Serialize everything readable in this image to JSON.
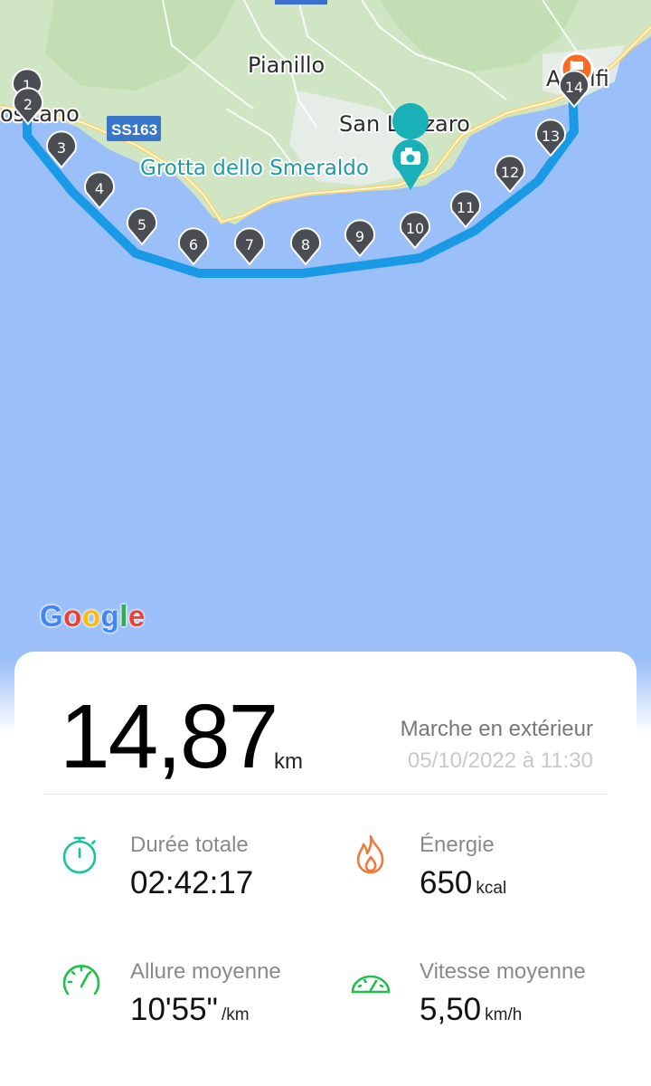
{
  "map": {
    "places": {
      "pianillo": "Pianillo",
      "san_lazzaro": "San Lazzaro",
      "poi_grotta": "Grotta dello Smeraldo",
      "positano_partial": "ositano",
      "amalfi_partial_left": "A",
      "amalfi_partial_right": "lfi"
    },
    "road_shield": "SS163",
    "route_color": "#1a9ae6",
    "sea_color": "#9bbff9",
    "land_color": "#cfe5c3",
    "waypoints": [
      "1",
      "2",
      "3",
      "4",
      "5",
      "6",
      "7",
      "8",
      "9",
      "10",
      "11",
      "12",
      "13",
      "14"
    ],
    "google_logo": {
      "G": "G",
      "o1": "o",
      "o2": "o",
      "g": "g",
      "l": "l",
      "e": "e"
    },
    "logo_colors": [
      "#4285F4",
      "#EA4335",
      "#FBBC05",
      "#4285F4",
      "#34A853",
      "#EA4335"
    ]
  },
  "summary": {
    "distance": "14,87",
    "distance_unit": "km",
    "activity": "Marche en extérieur",
    "date": "05/10/2022 à 11:30"
  },
  "metrics": {
    "duration": {
      "label": "Durée totale",
      "value": "02:42:17",
      "unit": "",
      "icon": "stopwatch-icon",
      "color": "#19c29a"
    },
    "energy": {
      "label": "Énergie",
      "value": "650",
      "unit": "kcal",
      "icon": "flame-icon",
      "color": "#f07a3b"
    },
    "pace": {
      "label": "Allure moyenne",
      "value": "10'55\"",
      "unit": "/km",
      "icon": "speedometer-icon",
      "color": "#1fbf4a"
    },
    "speed": {
      "label": "Vitesse moyenne",
      "value": "5,50",
      "unit": "km/h",
      "icon": "speedometer-icon",
      "color": "#1fbf4a"
    }
  }
}
